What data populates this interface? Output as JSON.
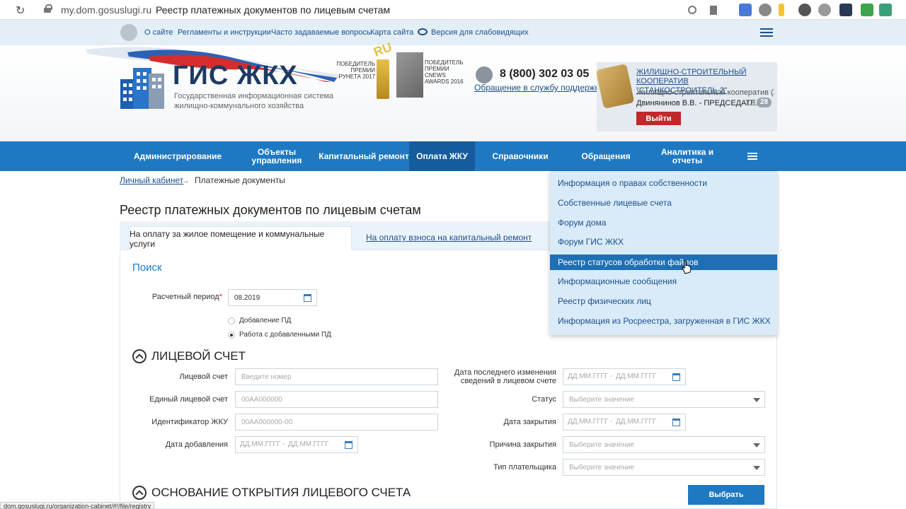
{
  "browser": {
    "url_domain": "my.dom.gosuslugi.ru",
    "url_title": "Реестр платежных документов по лицевым счетам",
    "status_url": "dom.gosuslugi.ru/organization-cabinet/#!/file/registry"
  },
  "toplinks": [
    "О сайте",
    "Регламенты и инструкции",
    "Часто задаваемые вопросы",
    "Карта сайта",
    "Версия для слабовидящих"
  ],
  "header": {
    "logo_title": "ГИС ЖКХ",
    "logo_subtitle": "Государственная информационная система жилищно-коммунального хозяйства",
    "award1": "ПОБЕДИТЕЛЬ ПРЕМИИ РУНЕТА 2017",
    "award1_badge": "RU",
    "award2": "ПОБЕДИТЕЛЬ ПРЕМИИ CNEWS AWARDS 2016",
    "phone": "8 (800) 302 03 05",
    "support_link": "Обращение в службу поддержки",
    "org_name": "ЖИЛИЩНО-СТРОИТЕЛЬНЫЙ КООПЕРАТИВ \"СТАНКОСТРОИТЕЛЬ-2\"",
    "org_type": "Жилищно-строительный кооператив (Ж...",
    "user": "Двинянинов В.В. - ПРЕДСЕДАТЕ...",
    "messages_count": "28",
    "logout": "Выйти"
  },
  "nav": {
    "items": [
      "Администрирование",
      "Объекты управления",
      "Капитальный ремонт",
      "Оплата ЖКУ",
      "Справочники",
      "Обращения",
      "Аналитика и отчеты"
    ],
    "active_index": 3
  },
  "breadcrumb": {
    "root": "Личный кабинет",
    "separator": "→",
    "current": "Платежные документы"
  },
  "page_title": "Реестр платежных документов по лицевым счетам",
  "tabs": {
    "active": "На оплату за жилое помещение и коммунальные услуги",
    "other": "На оплату взноса на капитальный ремонт"
  },
  "search": {
    "label": "Поиск",
    "period_label": "Расчетный период",
    "period_required": "*",
    "period_value": "08.2019",
    "radio1": "Добавление ПД",
    "radio2": "Работа с добавленными ПД",
    "radio_selected": 2
  },
  "account_section": {
    "heading": "ЛИЦЕВОЙ СЧЕТ",
    "account_label": "Лицевой счет",
    "account_placeholder": "Введите номер",
    "unified_label": "Единый лицевой счет",
    "unified_placeholder": "00АА000000",
    "jku_label": "Идентификатор ЖКУ",
    "jku_placeholder": "00АА000000-00",
    "added_label": "Дата добавления",
    "date_placeholder": "ДД.ММ.ГГГГ",
    "date_sep": "-",
    "last_change_label": "Дата последнего изменения сведений в лицевом счете",
    "status_label": "Статус",
    "select_placeholder": "Выберите значение",
    "close_date_label": "Дата закрытия",
    "close_reason_label": "Причина закрытия",
    "payer_type_label": "Тип плательщика"
  },
  "basis_section": {
    "heading": "ОСНОВАНИЕ ОТКРЫТИЯ ЛИЦЕВОГО СЧЕТА"
  },
  "select_button": "Выбрать",
  "dropdown": {
    "items": [
      "Информация о правах собственности",
      "Собственные лицевые счета",
      "Форум дома",
      "Форум ГИС ЖКХ",
      "Реестр статусов обработки файлов",
      "Информационные сообщения",
      "Реестр физических лиц",
      "Информация из Росреестра, загруженная в ГИС ЖКХ"
    ],
    "hover_index": 4
  },
  "colors": {
    "nav": "#1f78c2",
    "nav_active": "#145c9d",
    "logout": "#c0282a",
    "dropdown_bg": "#d9ebf8",
    "dropdown_hover": "#1f6fb5"
  }
}
